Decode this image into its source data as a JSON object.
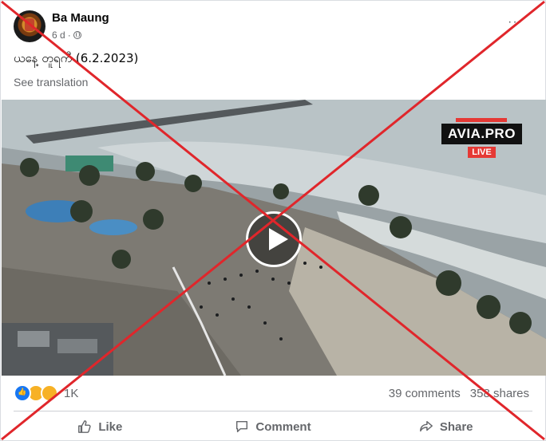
{
  "post": {
    "author": "Ba Maung",
    "time": "6 d",
    "caption": "ယနေ့ တူရကီ (6.2.2023)",
    "see_translation": "See translation",
    "more_icon": "···"
  },
  "video": {
    "watermark_name": "AVIA.PRO",
    "watermark_live": "LIVE"
  },
  "engagement": {
    "reaction_count": "1K",
    "comments": "39 comments",
    "shares": "358 shares"
  },
  "actions": {
    "like": "Like",
    "comment": "Comment",
    "share": "Share"
  },
  "overlay": {
    "cross_color": "#e0262b"
  }
}
